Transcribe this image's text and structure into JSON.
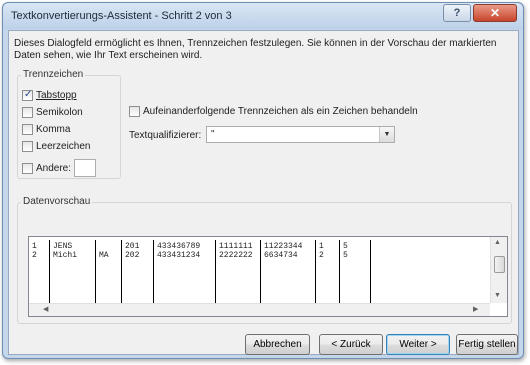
{
  "window": {
    "title": "Textkonvertierungs-Assistent - Schritt 2 von 3",
    "help_label": "?",
    "close_label": "✕"
  },
  "description": "Dieses Dialogfeld ermöglicht es Ihnen, Trennzeichen festzulegen. Sie können in der Vorschau der markierten Daten sehen, wie Ihr Text erscheinen wird.",
  "separators": {
    "legend": "Trennzeichen",
    "items": [
      {
        "label": "Tabstopp",
        "checked": true
      },
      {
        "label": "Semikolon",
        "checked": false
      },
      {
        "label": "Komma",
        "checked": false
      },
      {
        "label": "Leerzeichen",
        "checked": false
      },
      {
        "label": "Andere:",
        "checked": false
      }
    ],
    "other_value": ""
  },
  "consecutive": {
    "label": "Aufeinanderfolgende Trennzeichen als ein Zeichen behandeln",
    "checked": false
  },
  "text_qualifier": {
    "label": "Textqualifizierer:",
    "value": "\""
  },
  "preview": {
    "legend": "Datenvorschau",
    "rows": [
      [
        "1",
        "JENS",
        "",
        "201",
        "433436789",
        "1111111",
        "11223344",
        "1",
        "5"
      ],
      [
        "2",
        "Michi",
        "MA",
        "202",
        "433431234",
        "2222222",
        "6634734",
        "2",
        "5"
      ]
    ]
  },
  "buttons": {
    "cancel": "Abbrechen",
    "back": "< Zurück",
    "next": "Weiter >",
    "finish": "Fertig stellen"
  },
  "icons": {
    "check": "check-icon",
    "dropdown": "chevron-down-icon"
  }
}
